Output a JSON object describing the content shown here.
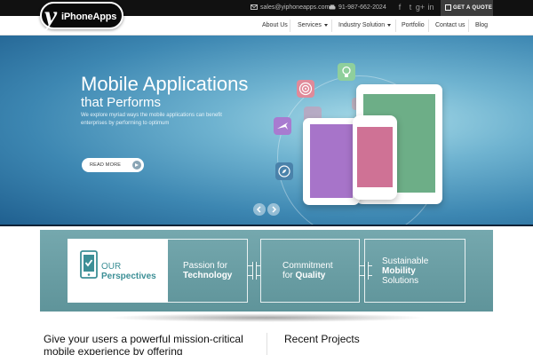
{
  "brand": {
    "logo_letter": "y",
    "logo_text": "iPhoneApps"
  },
  "topbar": {
    "email": "sales@yiphoneapps.com",
    "phone": "91-987-662-2024",
    "social": [
      "facebook-icon",
      "twitter-icon",
      "google-plus-icon",
      "linkedin-icon"
    ],
    "social_glyphs": [
      "f",
      "t",
      "g+",
      "in"
    ],
    "quote_label": "GET A QUOTE"
  },
  "nav": {
    "items": [
      {
        "label": "About Us",
        "dropdown": false
      },
      {
        "label": "Services",
        "dropdown": true
      },
      {
        "label": "Industry Solution",
        "dropdown": true
      },
      {
        "label": "Portfolio",
        "dropdown": false
      },
      {
        "label": "Contact us",
        "dropdown": false
      },
      {
        "label": "Blog",
        "dropdown": false
      }
    ]
  },
  "hero": {
    "title": "Mobile Applications",
    "subtitle": "that Performs",
    "description": "We explore myriad ways the mobile applications can benefit enterprises by performing to optimum",
    "cta_label": "READ MORE",
    "colors": {
      "background": "#3d87b2",
      "accent": "#ffffff"
    }
  },
  "perspectives": {
    "main": {
      "line1": "OUR",
      "line2": "Perspectives"
    },
    "cards": [
      {
        "line1": "Passion for",
        "line2": "Technology"
      },
      {
        "line1": "Commitment",
        "line2_prefix": "for ",
        "line2": "Quality"
      },
      {
        "line1": "Sustainable",
        "line2": "Mobility",
        "line3": "Solutions"
      }
    ],
    "colors": {
      "band": "#6fa2a8",
      "accent": "#3c8f96"
    }
  },
  "content": {
    "intro": "Give your users a powerful mission-critical mobile experience by offering",
    "recent_title": "Recent Projects"
  }
}
